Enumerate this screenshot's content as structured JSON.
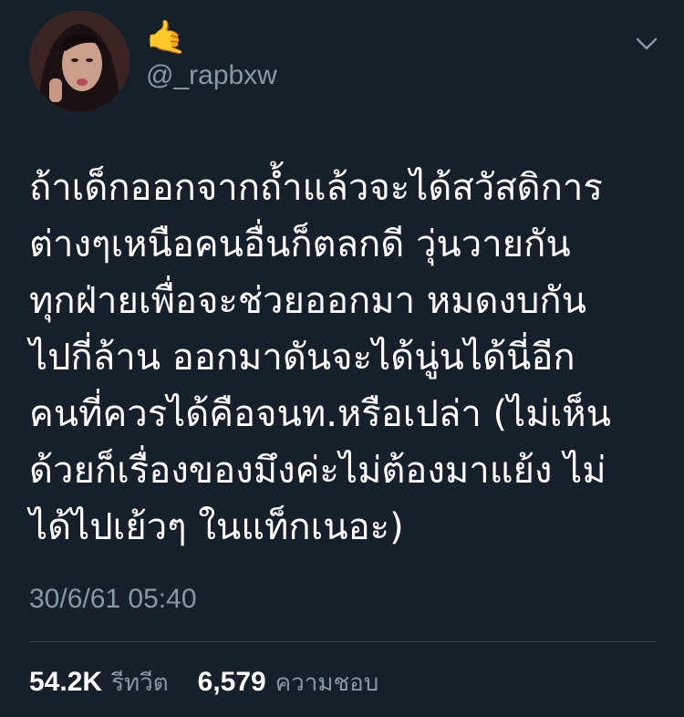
{
  "tweet": {
    "emoji": "🤙",
    "handle": "@_rapbxw",
    "text": "ถ้าเด็กออกจากถ้ำแล้วจะได้สวัสดิการ\nต่างๆเหนือคนอื่นก็ตลกดี วุ่นวายกัน\nทุกฝ่ายเพื่อจะช่วยออกมา หมดงบกัน\nไปกี่ล้าน ออกมาดันจะได้นู่นได้นี่อีก\nคนที่ควรได้คือจนท.หรือเปล่า (ไม่เห็น\nด้วยก็เรื่องของมึงค่ะไม่ต้องมาแย้ง ไม่\nได้ไปเย้วๆ ในแท็กเนอะ)",
    "timestamp": "30/6/61 05:40",
    "retweets_count": "54.2K",
    "retweets_label": "รีทวีต",
    "likes_count": "6,579",
    "likes_label": "ความชอบ"
  },
  "icons": {
    "menu": "chevron-down-icon",
    "avatar": "profile-avatar"
  }
}
